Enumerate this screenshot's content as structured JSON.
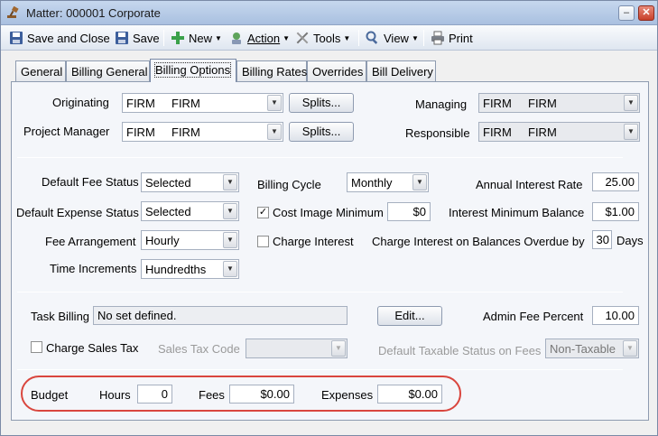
{
  "window": {
    "title": "Matter: 000001 Corporate",
    "controls": {
      "minimize": "–",
      "close": "✕"
    }
  },
  "toolbar": {
    "save_close": "Save and Close",
    "save": "Save",
    "new": "New",
    "action": "Action",
    "tools": "Tools",
    "view": "View",
    "print": "Print"
  },
  "tabs": [
    "General",
    "Billing General",
    "Billing Options",
    "Billing Rates",
    "Overrides",
    "Bill Delivery"
  ],
  "active_tab": "Billing Options",
  "top": {
    "originating_label": "Originating",
    "originating_code": "FIRM",
    "originating_name": "FIRM",
    "pm_label": "Project Manager",
    "pm_code": "FIRM",
    "pm_name": "FIRM",
    "splits_label": "Splits...",
    "managing_label": "Managing",
    "managing_code": "FIRM",
    "managing_name": "FIRM",
    "responsible_label": "Responsible",
    "responsible_code": "FIRM",
    "responsible_name": "FIRM"
  },
  "billing": {
    "fee_status_label": "Default Fee Status",
    "fee_status": "Selected",
    "expense_status_label": "Default Expense Status",
    "expense_status": "Selected",
    "fee_arrangement_label": "Fee Arrangement",
    "fee_arrangement": "Hourly",
    "time_increments_label": "Time Increments",
    "time_increments": "Hundredths",
    "cycle_label": "Billing Cycle",
    "cycle": "Monthly",
    "cost_image_label": "Cost Image Minimum",
    "cost_image_checked": true,
    "cost_image_value": "$0",
    "charge_interest_label": "Charge Interest",
    "charge_interest_checked": false,
    "annual_rate_label": "Annual Interest Rate",
    "annual_rate": "25.00",
    "interest_min_label": "Interest Minimum Balance",
    "interest_min": "$1.00",
    "overdue_label": "Charge Interest on Balances Overdue by",
    "overdue_days": "30",
    "days_label": "Days"
  },
  "task": {
    "task_billing_label": "Task Billing",
    "task_billing_value": "No set defined.",
    "edit_label": "Edit...",
    "admin_fee_label": "Admin Fee Percent",
    "admin_fee": "10.00",
    "charge_sales_tax_label": "Charge Sales Tax",
    "charge_sales_tax_checked": false,
    "sales_tax_code_label": "Sales Tax Code",
    "default_taxable_label": "Default Taxable Status on Fees",
    "default_taxable": "Non-Taxable"
  },
  "budget": {
    "label": "Budget",
    "hours_label": "Hours",
    "hours": "0",
    "fees_label": "Fees",
    "fees": "$0.00",
    "expenses_label": "Expenses",
    "expenses": "$0.00"
  },
  "colors": {
    "highlight_oval": "#d9463e",
    "titlebar": "#b8cbe6"
  }
}
